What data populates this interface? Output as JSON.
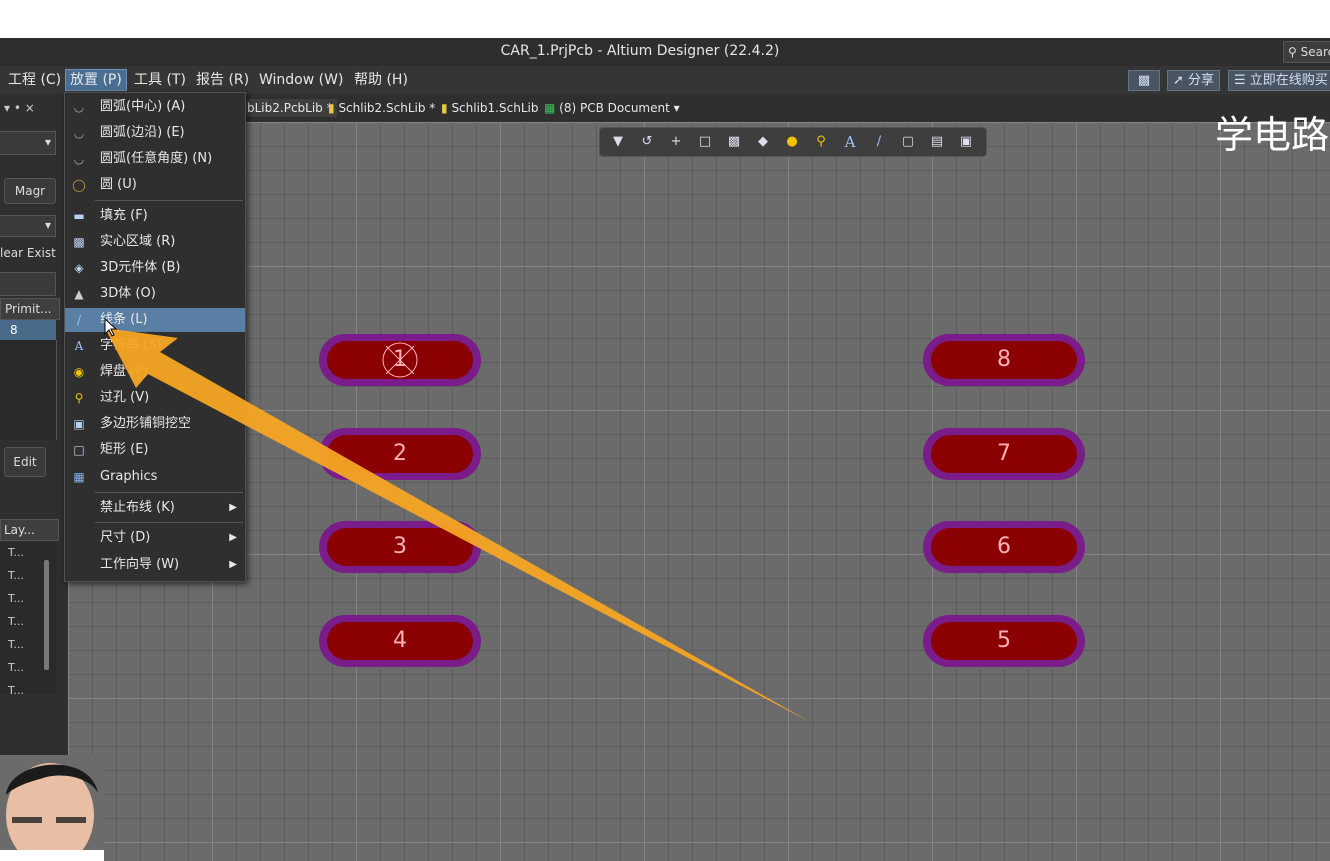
{
  "window": {
    "title": "CAR_1.PrjPcb - Altium Designer (22.4.2)",
    "search": "Search"
  },
  "menubar": {
    "items": [
      "工程 (C)",
      "放置 (P)",
      "工具 (T)",
      "报告 (R)",
      "Window (W)",
      "帮助 (H)"
    ],
    "share": "分享",
    "buy": "立即在线购买"
  },
  "tabs": [
    "bLib2.PcbLib *",
    "Schlib2.SchLib *",
    "Schlib1.SchLib",
    "(8) PCB Document"
  ],
  "watermark": "学电路",
  "left_panel": {
    "magr": "Magr",
    "clear": "lear Exist",
    "primit": "Primit...",
    "value": "8",
    "edit": "Edit",
    "lay": "Lay...",
    "rows": [
      "T...",
      "T...",
      "T...",
      "T...",
      "T...",
      "T...",
      "T..."
    ]
  },
  "place_menu": [
    {
      "icon": "arc-center-icon",
      "label": "圆弧(中心) (A)"
    },
    {
      "icon": "arc-edge-icon",
      "label": "圆弧(边沿) (E)"
    },
    {
      "icon": "arc-any-icon",
      "label": "圆弧(任意角度) (N)"
    },
    {
      "icon": "circle-icon",
      "label": "圆 (U)"
    },
    {
      "icon": "fill-icon",
      "label": "填充 (F)"
    },
    {
      "icon": "solid-region-icon",
      "label": "实心区域 (R)"
    },
    {
      "icon": "3d-body-icon",
      "label": "3D元件体 (B)"
    },
    {
      "icon": "3d-solid-icon",
      "label": "3D体 (O)"
    },
    {
      "icon": "line-icon",
      "label": "线条 (L)"
    },
    {
      "icon": "string-icon",
      "label": "字符串 (S)"
    },
    {
      "icon": "pad-icon",
      "label": "焊盘 (P)"
    },
    {
      "icon": "via-icon",
      "label": "过孔 (V)"
    },
    {
      "icon": "polygon-cutout-icon",
      "label": "多边形铺铜挖空"
    },
    {
      "icon": "rectangle-icon",
      "label": "矩形 (E)"
    },
    {
      "icon": "graphics-icon",
      "label": "Graphics"
    },
    {
      "icon": "",
      "label": "禁止布线 (K)"
    },
    {
      "icon": "",
      "label": "尺寸 (D)"
    },
    {
      "icon": "",
      "label": "工作向导 (W)"
    }
  ],
  "pads": [
    "1",
    "2",
    "3",
    "4",
    "8",
    "7",
    "6",
    "5"
  ],
  "colors": {
    "pad_outer": "#7a1d8a",
    "pad_inner": "#8b0000",
    "arrow": "#f6a623",
    "highlight": "#5a7fa5"
  }
}
